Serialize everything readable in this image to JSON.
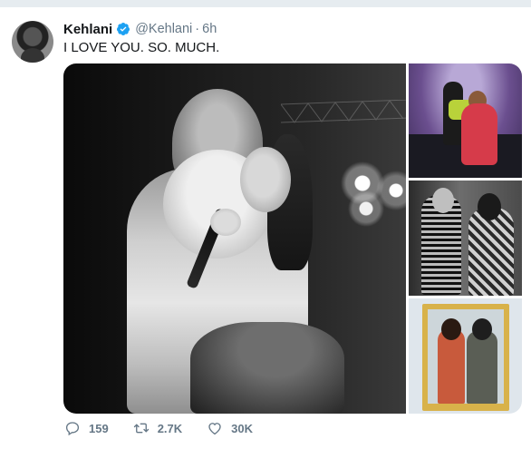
{
  "tweet": {
    "author_name": "Kehlani",
    "handle": "@Kehlani",
    "separator": "·",
    "time": "6h",
    "text": "I LOVE YOU. SO. MUCH."
  },
  "media": {
    "count": 4
  },
  "actions": {
    "reply_count": "159",
    "retweet_count": "2.7K",
    "like_count": "30K"
  },
  "colors": {
    "verified_badge": "#1da1f2",
    "icon_gray": "#657786",
    "text_primary": "#14171a",
    "background": "#ffffff"
  },
  "icons": [
    "verified-badge-icon",
    "reply-icon",
    "retweet-icon",
    "like-icon"
  ]
}
